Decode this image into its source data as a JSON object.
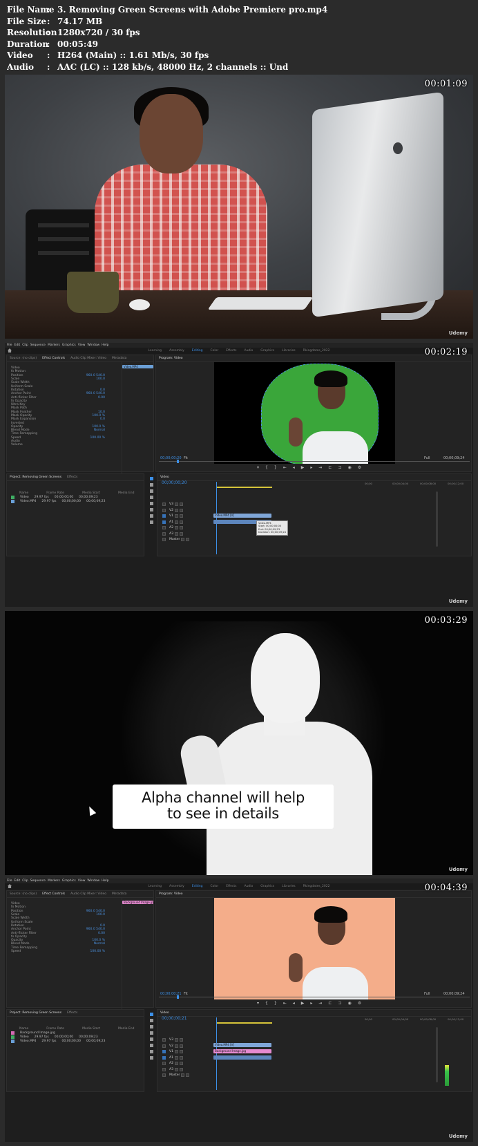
{
  "file_info": [
    {
      "key": "File Name",
      "value": "3. Removing Green Screens with Adobe Premiere pro.mp4"
    },
    {
      "key": "File Size",
      "value": "74.17 MB"
    },
    {
      "key": "Resolution",
      "value": "1280x720 / 30 fps"
    },
    {
      "key": "Duration",
      "value": "00:05:49"
    },
    {
      "key": "Video",
      "value": "H264 (Main) :: 1.61 Mb/s, 30 fps"
    },
    {
      "key": "Audio",
      "value": "AAC (LC) :: 128 kb/s, 48000 Hz, 2 channels :: Und"
    }
  ],
  "frames": [
    {
      "timestamp": "00:01:09",
      "watermark": "Udemy"
    },
    {
      "timestamp": "00:02:19",
      "watermark": "Udemy"
    },
    {
      "timestamp": "00:03:29",
      "watermark": "Udemy",
      "caption_line1": "Alpha channel will help",
      "caption_line2": "to see in details"
    },
    {
      "timestamp": "00:04:39",
      "watermark": "Udemy"
    }
  ],
  "premiere": {
    "menu": [
      "File",
      "Edit",
      "Clip",
      "Sequence",
      "Markers",
      "Graphics",
      "View",
      "Window",
      "Help"
    ],
    "workspaces": [
      "Learning",
      "Assembly",
      "Editing",
      "Color",
      "Effects",
      "Audio",
      "Graphics",
      "Libraries",
      "Rkingdates_2022"
    ],
    "active_workspace": "Editing",
    "top_left_tabs": [
      "Source: (no clips)",
      "Effect Controls",
      "Audio Clip Mixer: Video",
      "Metadata"
    ],
    "program_label": "Program: Video",
    "effect_rows_f2": [
      "Video",
      "fx Motion",
      "Position",
      "Scale",
      "Scale Width",
      "Uniform Scale",
      "Rotation",
      "Anchor Point",
      "Anti-flicker Filter",
      "fx Opacity",
      "Ultra Key",
      "Mask Path",
      "Mask Feather",
      "Mask Opacity",
      "Mask Expansion",
      "Inverted",
      "Opacity",
      "Blend Mode",
      "Time Remapping",
      "Speed",
      "Audio",
      "Volume"
    ],
    "effect_values_f2": [
      "",
      "",
      "960.0  540.0",
      "100.0",
      "",
      "",
      "0.0",
      "960.0  540.0",
      "0.00",
      "",
      "",
      "",
      "10.0",
      "100.0 %",
      "0.0",
      "",
      "100.0 %",
      "Normal",
      "",
      "100.00 %",
      "",
      ""
    ],
    "effect_rows_f4": [
      "Video",
      "fx Motion",
      "Position",
      "Scale",
      "Scale Width",
      "Uniform Scale",
      "Rotation",
      "Anchor Point",
      "Anti-flicker Filter",
      "fx Opacity",
      "Opacity",
      "Blend Mode",
      "Time Remapping",
      "Speed"
    ],
    "effect_values_f4": [
      "",
      "",
      "960.0  540.0",
      "100.0",
      "",
      "",
      "0.0",
      "960.0  540.0",
      "0.00",
      "",
      "100.0 %",
      "Normal",
      "",
      "100.00 %"
    ],
    "clip_label_f2": "Video.MP4",
    "clip_label_f4": "Background Image.jpg",
    "program_tc_f2": "00;00;00;20",
    "program_tc_f4": "00;00;00;21",
    "program_fit": "Fit",
    "program_full": "Full",
    "program_duration": "00;00;09;24",
    "timeline_tc_f2": "00;00;00;20",
    "timeline_tc_f4": "00;00;00;21",
    "ruler": [
      "00;00",
      "00;00;04;00",
      "00;00;08;00",
      "00;00;12;00",
      "00;00;16;00",
      "00;00;20;00",
      "00;00;24;00",
      "00;00;28;00",
      "00;00;32;00"
    ],
    "project_tab": "Project: Removing Green Screens",
    "effects_tab": "Effects",
    "project_cols": [
      "Name",
      "Frame Rate",
      "Media Start",
      "Media End"
    ],
    "project_items_f2": [
      {
        "name": "Video",
        "rate": "29.97 fps",
        "start": "00;00;00;00",
        "end": "00;00;09;23",
        "color": "#3fae63"
      },
      {
        "name": "Video.MP4",
        "rate": "29.97 fps",
        "start": "00;00;00;00",
        "end": "00;00;09;23",
        "color": "#6aa0d8"
      }
    ],
    "project_items_f4": [
      {
        "name": "Background Image.jpg",
        "rate": "",
        "start": "",
        "end": "",
        "color": "#d56ab5"
      },
      {
        "name": "Video",
        "rate": "29.97 fps",
        "start": "00;00;00;00",
        "end": "00;00;09;23",
        "color": "#3fae63"
      },
      {
        "name": "Video.MP4",
        "rate": "29.97 fps",
        "start": "00;00;00;00",
        "end": "00;00;09;23",
        "color": "#6aa0d8"
      }
    ],
    "tracks": [
      "V3",
      "V2",
      "V1",
      "A1",
      "A2",
      "A3",
      "Master"
    ],
    "timeline_clip_f2": "Video.MP4 [V]",
    "timeline_clip_f4_top": "Video.MP4 [V]",
    "timeline_clip_f4_bottom": "Background Image.jpg",
    "tooltip": [
      "Video.MP4",
      "Start: 00;00;00;00",
      "End: 00;00;09;23",
      "Duration: 00;00;09;24"
    ]
  },
  "colors": {
    "accent_blue": "#3c8fe6",
    "green_screen": "#3aa63a",
    "peach_bg": "#f4ad8a",
    "clip_blue": "#7fa6d8",
    "clip_pink": "#e58ad0"
  }
}
